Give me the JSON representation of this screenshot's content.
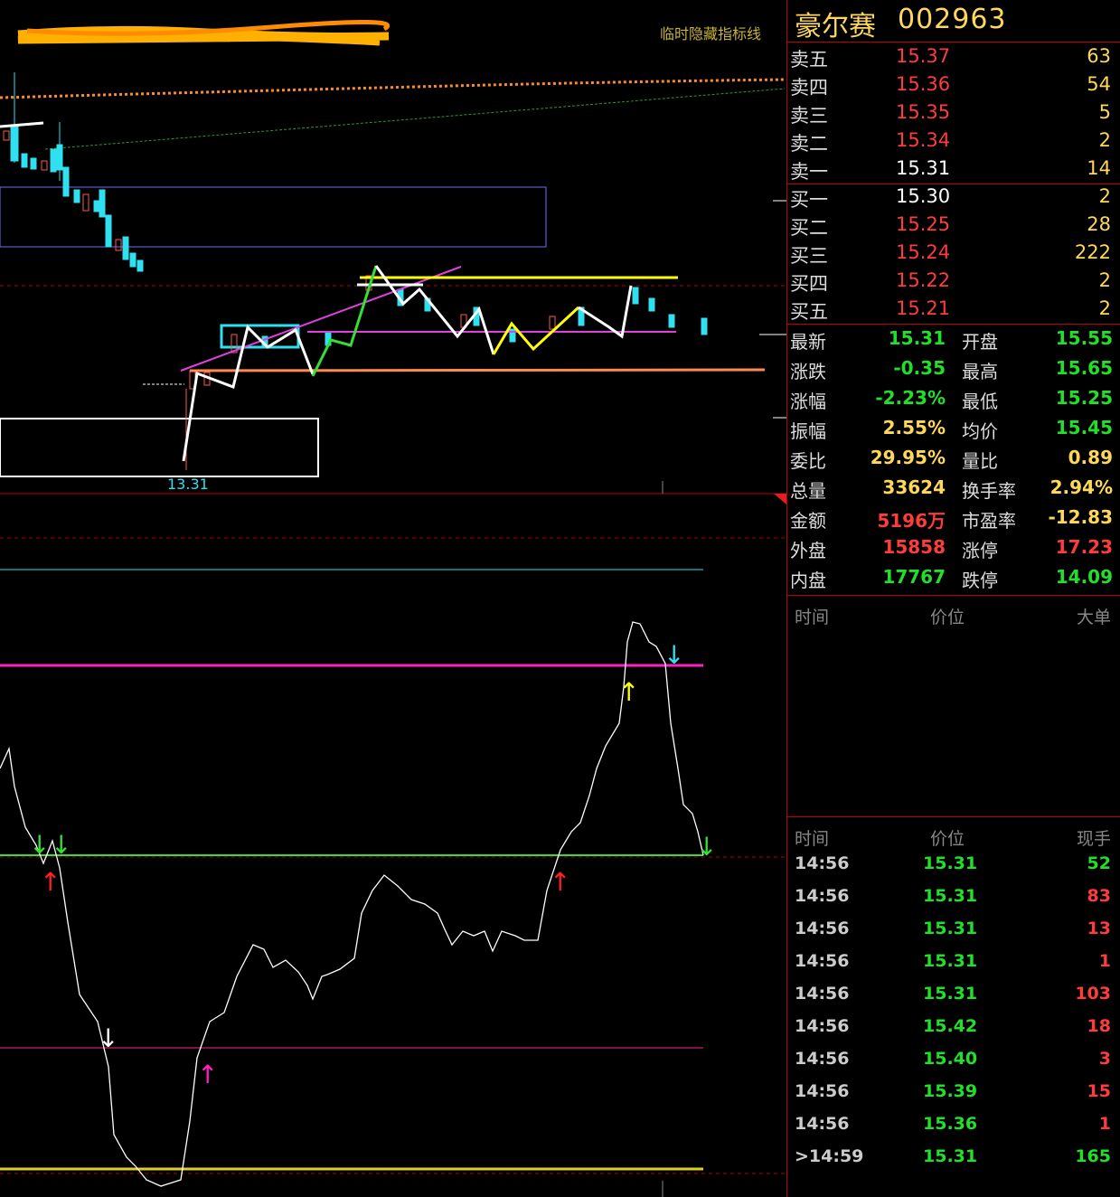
{
  "chart": {
    "hide_indicator_label": "临时隐藏指标线",
    "low_price_label": "13.31"
  },
  "stock": {
    "name": "豪尔赛",
    "code": "002963"
  },
  "order_book": {
    "asks": [
      {
        "label": "卖五",
        "price": "15.37",
        "volume": "63",
        "color": "#ff3c3c"
      },
      {
        "label": "卖四",
        "price": "15.36",
        "volume": "54",
        "color": "#ff3c3c"
      },
      {
        "label": "卖三",
        "price": "15.35",
        "volume": "5",
        "color": "#ff3c3c"
      },
      {
        "label": "卖二",
        "price": "15.34",
        "volume": "2",
        "color": "#ff3c3c"
      },
      {
        "label": "卖一",
        "price": "15.31",
        "volume": "14",
        "color": "#ffffff"
      }
    ],
    "bids": [
      {
        "label": "买一",
        "price": "15.30",
        "volume": "2",
        "color": "#ffffff"
      },
      {
        "label": "买二",
        "price": "15.25",
        "volume": "28",
        "color": "#ff3c3c"
      },
      {
        "label": "买三",
        "price": "15.24",
        "volume": "222",
        "color": "#ff3c3c"
      },
      {
        "label": "买四",
        "price": "15.22",
        "volume": "2",
        "color": "#ff3c3c"
      },
      {
        "label": "买五",
        "price": "15.21",
        "volume": "2",
        "color": "#ff3c3c"
      }
    ]
  },
  "quote": [
    {
      "k1": "最新",
      "v1": "15.31",
      "c1": "#22e02a",
      "k2": "开盘",
      "v2": "15.55",
      "c2": "#22e02a"
    },
    {
      "k1": "涨跌",
      "v1": "-0.35",
      "c1": "#22e02a",
      "k2": "最高",
      "v2": "15.65",
      "c2": "#22e02a"
    },
    {
      "k1": "涨幅",
      "v1": "-2.23%",
      "c1": "#22e02a",
      "k2": "最低",
      "v2": "15.25",
      "c2": "#22e02a"
    },
    {
      "k1": "振幅",
      "v1": "2.55%",
      "c1": "#ffd85a",
      "k2": "均价",
      "v2": "15.45",
      "c2": "#22e02a"
    },
    {
      "k1": "委比",
      "v1": "29.95%",
      "c1": "#ffd85a",
      "k2": "量比",
      "v2": "0.89",
      "c2": "#ffd85a"
    },
    {
      "k1": "总量",
      "v1": "33624",
      "c1": "#ffd85a",
      "k2": "换手率",
      "v2": "2.94%",
      "c2": "#ffd85a"
    },
    {
      "k1": "金额",
      "v1": "5196万",
      "c1": "#ff3c3c",
      "k2": "市盈率",
      "v2": "-12.83",
      "c2": "#ffd85a"
    },
    {
      "k1": "外盘",
      "v1": "15858",
      "c1": "#ff3c3c",
      "k2": "涨停",
      "v2": "17.23",
      "c2": "#ff3c3c"
    },
    {
      "k1": "内盘",
      "v1": "17767",
      "c1": "#22e02a",
      "k2": "跌停",
      "v2": "14.09",
      "c2": "#22e02a"
    }
  ],
  "big_orders_header": {
    "time": "时间",
    "price": "价位",
    "size": "大单"
  },
  "ticks_header": {
    "time": "时间",
    "price": "价位",
    "size": "现手"
  },
  "ticks": [
    {
      "time": "14:56",
      "price": "15.31",
      "size": "52",
      "color": "#22e02a"
    },
    {
      "time": "14:56",
      "price": "15.31",
      "size": "83",
      "color": "#ff3c3c"
    },
    {
      "time": "14:56",
      "price": "15.31",
      "size": "13",
      "color": "#ff3c3c"
    },
    {
      "time": "14:56",
      "price": "15.31",
      "size": "1",
      "color": "#ff3c3c"
    },
    {
      "time": "14:56",
      "price": "15.31",
      "size": "103",
      "color": "#ff3c3c"
    },
    {
      "time": "14:56",
      "price": "15.42",
      "size": "18",
      "color": "#ff3c3c"
    },
    {
      "time": "14:56",
      "price": "15.40",
      "size": "3",
      "color": "#ff3c3c"
    },
    {
      "time": "14:56",
      "price": "15.39",
      "size": "15",
      "color": "#ff3c3c"
    },
    {
      "time": "14:56",
      "price": "15.36",
      "size": "1",
      "color": "#ff3c3c"
    },
    {
      "time": ">14:59",
      "price": "15.31",
      "size": "165",
      "color": "#22e02a"
    }
  ]
}
